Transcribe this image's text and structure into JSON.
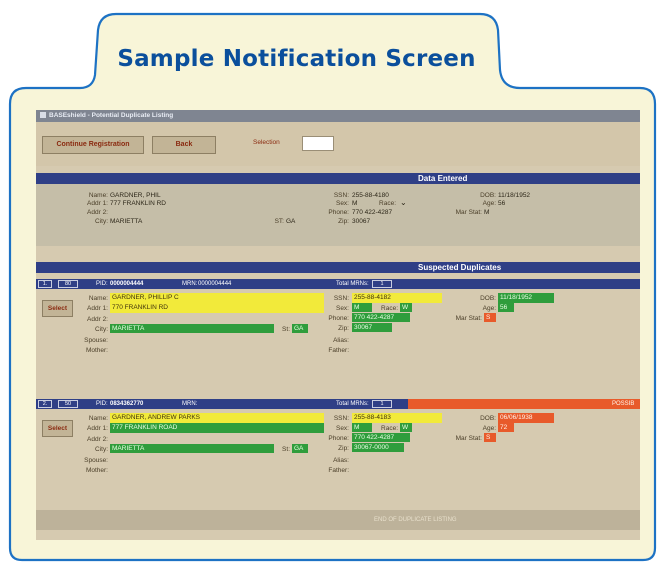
{
  "page": {
    "heading": "Sample Notification Screen"
  },
  "window": {
    "title": "BASEshield - Potential Duplicate Listing"
  },
  "toolbar": {
    "continue_label": "Continue Registration",
    "back_label": "Back",
    "selection_label": "Selection",
    "selection_value": ""
  },
  "entered": {
    "header": "Data Entered",
    "name_label": "Name:",
    "name": "GARDNER, PHIL",
    "addr1_label": "Addr 1:",
    "addr1": "777 FRANKLIN RD",
    "addr2_label": "Addr 2:",
    "city_label": "City:",
    "city": "MARIETTA",
    "st_label": "ST:",
    "st": "GA",
    "ssn_label": "SSN:",
    "ssn": "255-88-4180",
    "sex_label": "Sex:",
    "sex": "M",
    "race_label": "Race:",
    "phone_label": "Phone:",
    "phone": "770 422-4287",
    "zip_label": "Zip:",
    "zip": "30067",
    "dob_label": "DOB:",
    "dob": "11/18/1952",
    "age_label": "Age:",
    "age": "56",
    "marstat_label": "Mar Stat:",
    "marstat": "M"
  },
  "suspected": {
    "header": "Suspected Duplicates"
  },
  "labels": {
    "pid": "PID:",
    "mrn": "MRN:",
    "total_mrns": "Total MRNs:",
    "select": "Select",
    "name": "Name:",
    "addr1": "Addr 1:",
    "addr2": "Addr 2:",
    "city": "City:",
    "st": "St:",
    "spouse": "Spouse:",
    "mother": "Mother:",
    "ssn": "SSN:",
    "sex": "Sex:",
    "race": "Race:",
    "phone": "Phone:",
    "zip": "Zip:",
    "alias": "Alias:",
    "father": "Father:",
    "dob": "DOB:",
    "age": "Age:",
    "marstat": "Mar Stat:"
  },
  "duplicates": [
    {
      "index": "1.",
      "score": "80",
      "pid": "0000004444",
      "mrn": "0000004444",
      "total_mrns": "1",
      "status": "",
      "name": "GARDNER, PHILLIP C",
      "addr1": "770 FRANKLIN RD",
      "city": "MARIETTA",
      "st": "GA",
      "ssn": "255-88-4182",
      "sex": "M",
      "race": "W",
      "phone": "770 422-4287",
      "zip": "30067",
      "dob": "11/18/1952",
      "age": "56",
      "marstat": "S"
    },
    {
      "index": "2.",
      "score": "50",
      "pid": "0834362770",
      "mrn": "",
      "total_mrns": "1",
      "status": "POSSIB",
      "name": "GARDNER, ANDREW PARKS",
      "addr1": "777 FRANKLIN ROAD",
      "city": "MARIETTA",
      "st": "GA",
      "ssn": "255-88-4183",
      "sex": "M",
      "race": "W",
      "phone": "770 422-4287",
      "zip": "30067-0000",
      "dob": "06/06/1938",
      "age": "72",
      "marstat": "S"
    }
  ],
  "footer": {
    "text": "END OF DUPLICATE LISTING"
  },
  "colors": {
    "frame": "#1d72c4",
    "frame_fill": "#f8f5d8",
    "heading": "#0b4f9c",
    "band": "#2f3f86",
    "yellow": "#f2ea3a",
    "green": "#2f9d3c",
    "orange": "#e85a2a"
  }
}
